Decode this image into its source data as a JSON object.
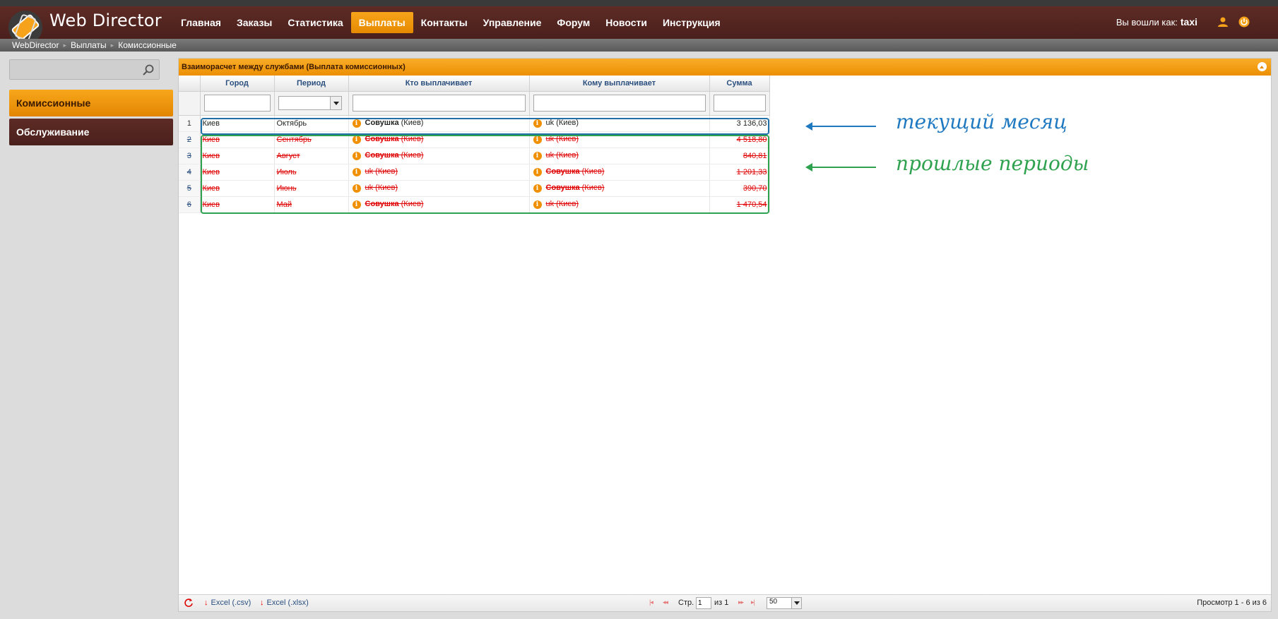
{
  "app": {
    "title": "Web Director"
  },
  "nav": {
    "items": [
      {
        "label": "Главная",
        "active": false
      },
      {
        "label": "Заказы",
        "active": false
      },
      {
        "label": "Статистика",
        "active": false
      },
      {
        "label": "Выплаты",
        "active": true
      },
      {
        "label": "Контакты",
        "active": false
      },
      {
        "label": "Управление",
        "active": false
      },
      {
        "label": "Форум",
        "active": false
      },
      {
        "label": "Новости",
        "active": false
      },
      {
        "label": "Инструкция",
        "active": false
      }
    ]
  },
  "user": {
    "logged_in_label": "Вы вошли как:",
    "name": "taxi"
  },
  "breadcrumb": [
    "WebDirector",
    "Выплаты",
    "Комиссионные"
  ],
  "sidebar": {
    "search_value": "",
    "items": [
      {
        "label": "Комиссионные",
        "active": true
      },
      {
        "label": "Обслуживание",
        "active": false
      }
    ]
  },
  "panel": {
    "title": "Взаиморасчет между службами (Выплата комиссионных)",
    "columns": [
      "Город",
      "Период",
      "Кто выплачивает",
      "Кому выплачивает",
      "Сумма"
    ],
    "rows": [
      {
        "n": "1",
        "city": "Киев",
        "period": "Октябрь",
        "payer_bold": "Совушка",
        "payer_rest": " (Киев)",
        "payee_bold": "",
        "payee_rest": "uk (Киев)",
        "sum": "3 136,03",
        "old": false
      },
      {
        "n": "2",
        "city": "Киев",
        "period": "Сентябрь",
        "payer_bold": "Совушка",
        "payer_rest": " (Киев)",
        "payee_bold": "",
        "payee_rest": "uk (Киев)",
        "sum": "4 518,80",
        "old": true
      },
      {
        "n": "3",
        "city": "Киев",
        "period": "Август",
        "payer_bold": "Совушка",
        "payer_rest": " (Киев)",
        "payee_bold": "",
        "payee_rest": "uk (Киев)",
        "sum": "840,81",
        "old": true
      },
      {
        "n": "4",
        "city": "Киев",
        "period": "Июль",
        "payer_bold": "",
        "payer_rest": "uk (Киев)",
        "payee_bold": "Совушка",
        "payee_rest": " (Киев)",
        "sum": "1 201,33",
        "old": true
      },
      {
        "n": "5",
        "city": "Киев",
        "period": "Июнь",
        "payer_bold": "",
        "payer_rest": "uk (Киев)",
        "payee_bold": "Совушка",
        "payee_rest": " (Киев)",
        "sum": "390,70",
        "old": true
      },
      {
        "n": "6",
        "city": "Киев",
        "period": "Май",
        "payer_bold": "Совушка",
        "payer_rest": " (Киев)",
        "payee_bold": "",
        "payee_rest": "uk (Киев)",
        "sum": "1 470,54",
        "old": true
      }
    ]
  },
  "pager": {
    "export_csv": "Excel (.csv)",
    "export_xlsx": "Excel (.xlsx)",
    "page_label": "Стр.",
    "page_value": "1",
    "of_label": "из 1",
    "page_size": "50",
    "summary": "Просмотр 1 - 6 из 6"
  },
  "annotations": {
    "current": "текущий месяц",
    "past": "прошлые периоды"
  },
  "colors": {
    "header": "#5e2b25",
    "accent": "#f39800",
    "link": "#2a4f7e",
    "strike": "#e00000",
    "annot_blue": "#1f79c0",
    "annot_green": "#2ea24e"
  }
}
